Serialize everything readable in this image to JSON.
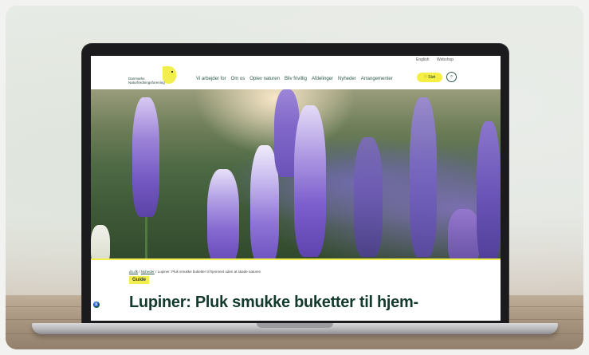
{
  "site": {
    "logo_text": "Danmarks Naturfredningsforening",
    "topbar": {
      "lang": "English",
      "shop": "Webshop"
    },
    "nav": [
      "Vi arbejder for",
      "Om os",
      "Oplev naturen",
      "Bliv frivillig",
      "Afdelinger",
      "Nyheder",
      "Arrangementer"
    ],
    "cta_label": "Støt",
    "search_icon": "search-icon"
  },
  "article": {
    "breadcrumb": {
      "home": "dn.dk",
      "section": "Nyheder",
      "current": "Lupiner: Pluk smukke buketter til hjemmet uden at skade naturen"
    },
    "tag": "Guide",
    "headline": "Lupiner: Pluk smukke buketter til hjem-"
  },
  "colors": {
    "brand_yellow": "#f2ee4d",
    "brand_green": "#143a2e"
  }
}
